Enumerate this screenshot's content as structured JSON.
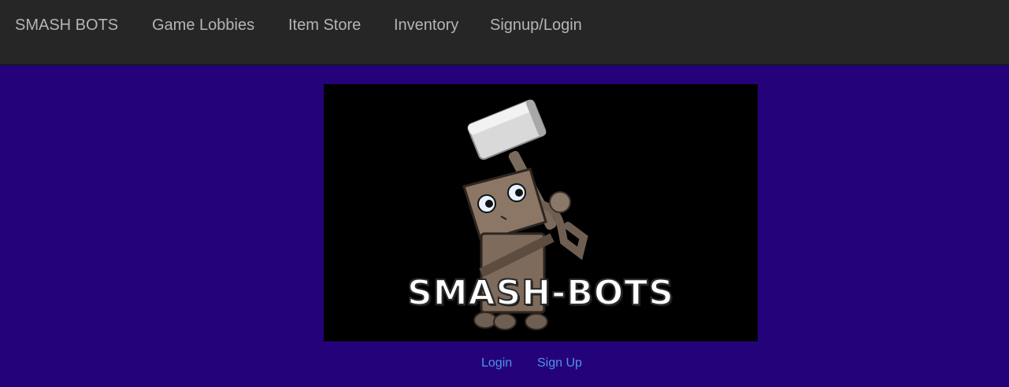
{
  "navbar": {
    "brand": "SMASH BOTS",
    "items": [
      {
        "label": "Game Lobbies"
      },
      {
        "label": "Item Store"
      },
      {
        "label": "Inventory"
      },
      {
        "label": "Signup/Login"
      }
    ]
  },
  "hero": {
    "logo_text": "SMASH-BOTS",
    "image_subject": "robot-with-hammer"
  },
  "auth": {
    "login_label": "Login",
    "signup_label": "Sign Up"
  },
  "colors": {
    "navbar_bg": "#262626",
    "page_bg": "#24037a",
    "nav_text": "#b5b5b5",
    "link": "#4f93ea"
  }
}
